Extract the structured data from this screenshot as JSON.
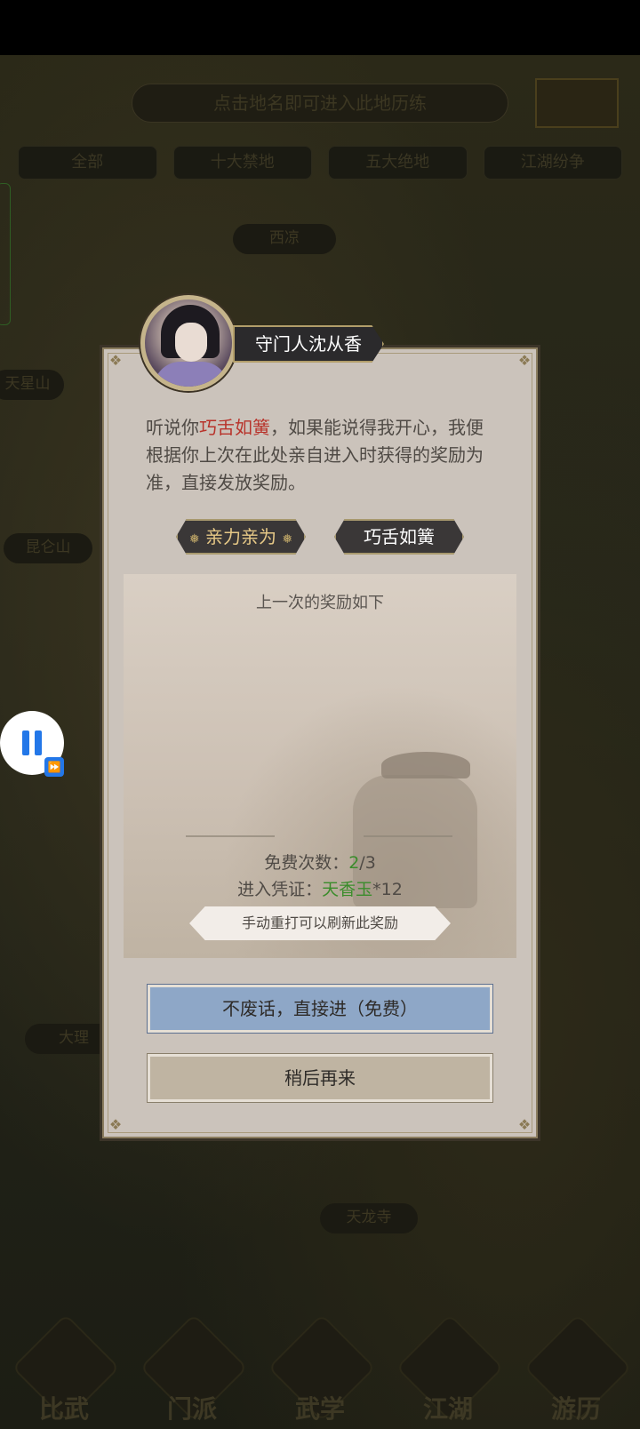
{
  "background": {
    "hint": "点击地名即可进入此地历练",
    "filter_tabs": [
      "全部",
      "十大禁地",
      "五大绝地",
      "江湖纷争"
    ],
    "places": [
      "西凉",
      "天星山",
      "昆仑山",
      "大理",
      "天龙寺"
    ],
    "bottom_nav": [
      "比武",
      "门派",
      "武学",
      "江湖",
      "游历"
    ]
  },
  "dialog": {
    "npc_name": "守门人沈从香",
    "text_parts": [
      "听说你",
      "巧舌如簧",
      "，如果能说得我开心，我便根据你上次在此处亲自进入时获得的奖励为准，直接发放奖励。"
    ],
    "buttons": {
      "self": "亲力亲为",
      "talk": "巧舌如簧"
    },
    "reward": {
      "title": "上一次的奖励如下",
      "free_label": "免费次数：",
      "free_used": "2",
      "free_total": "/3",
      "ticket_label": "进入凭证：",
      "ticket_item": "天香玉",
      "ticket_count": "*12",
      "refresh_note": "手动重打可以刷新此奖励"
    },
    "enter_button": "不废话，直接进（免费）",
    "later_button": "稍后再来"
  },
  "colors": {
    "highlight_red": "#b8322a",
    "green": "#3a8c2b",
    "blue_button": "#8ea7c7",
    "pause_blue": "#2377e8"
  }
}
